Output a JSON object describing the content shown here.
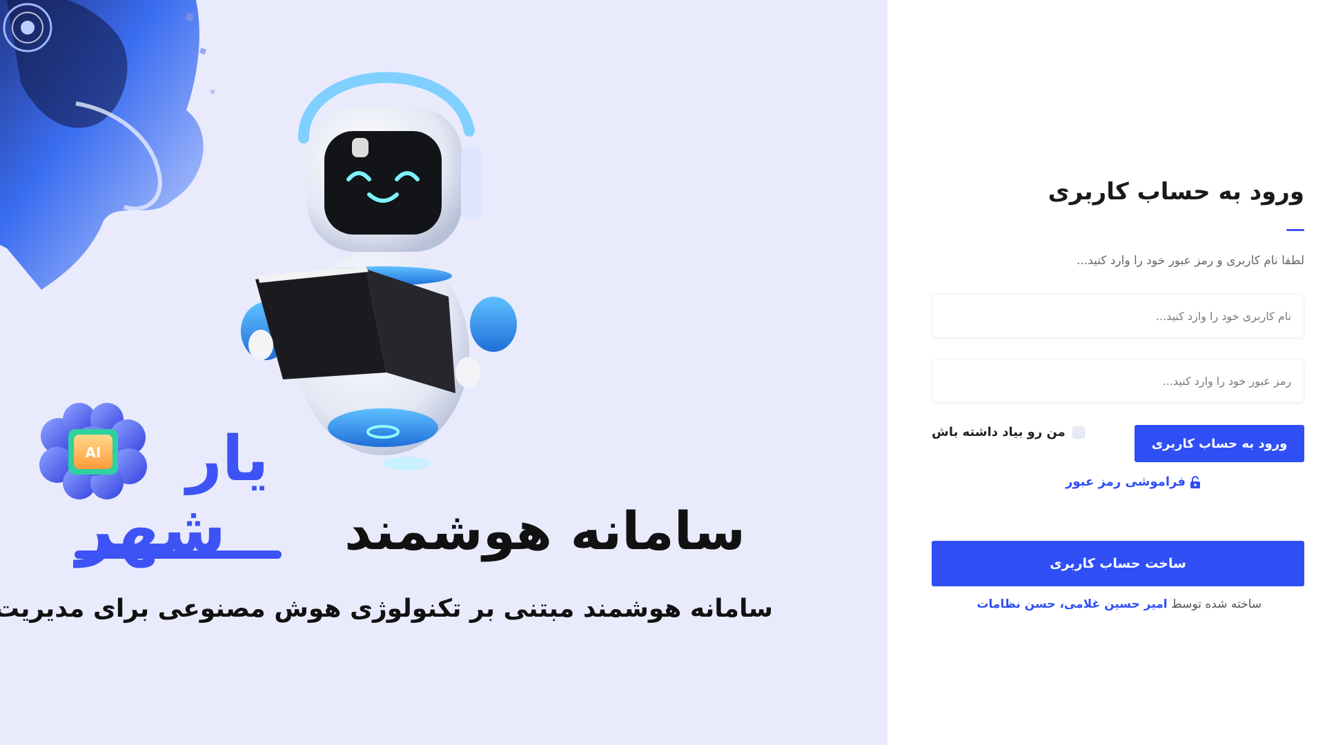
{
  "hero": {
    "headline": "سامانه هوشمند",
    "brand_part1": "شهر",
    "brand_part2": "یار",
    "ai_badge": "AI",
    "subline": "سامانه هوشمند مبتنی بر تکنولوژی هوش مصنوعی برای مدیریت شهری"
  },
  "login": {
    "title": "ورود به حساب کاربری",
    "hint": "لطفا نام کاربری و رمز عبور خود را وارد کنید...",
    "username_placeholder": "نام کاربری خود را وارد کنید...",
    "password_placeholder": "رمز عبور خود را وارد کنید...",
    "remember_label": "من رو بیاد داشته باش",
    "login_button": "ورود به حساب کاربری",
    "forgot_label": "فراموشی رمز عبور",
    "register_button": "ساخت حساب کاربری",
    "credit_prefix": "ساخته شده توسط",
    "credit_names": "امیر حسین غلامی، حسن نظامات"
  },
  "colors": {
    "accent": "#2f4ff5",
    "brand_blue": "#3d53f5",
    "hero_background": "#e9ebfd"
  },
  "icons": [
    "ai-head-illustration",
    "robot-illustration",
    "brain-chip-icon",
    "lock-icon"
  ]
}
